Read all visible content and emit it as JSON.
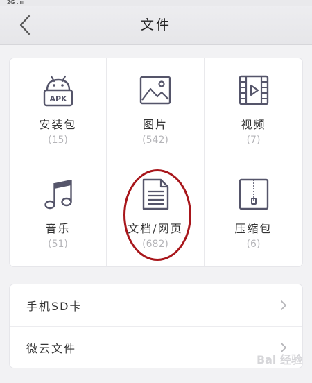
{
  "status_bar": {
    "text": "2G .ıııı"
  },
  "header": {
    "title": "文件",
    "back_icon": "chevron-left-icon"
  },
  "categories": [
    {
      "label": "安装包",
      "count": "(15)",
      "icon": "apk-android-icon"
    },
    {
      "label": "图片",
      "count": "(542)",
      "icon": "image-icon"
    },
    {
      "label": "视频",
      "count": "(7)",
      "icon": "video-icon"
    },
    {
      "label": "音乐",
      "count": "(51)",
      "icon": "music-note-icon"
    },
    {
      "label": "文档/网页",
      "count": "(682)",
      "icon": "document-icon"
    },
    {
      "label": "压缩包",
      "count": "(6)",
      "icon": "zip-archive-icon"
    }
  ],
  "apk_badge": "APK",
  "list": [
    {
      "label": "手机SD卡"
    },
    {
      "label": "微云文件"
    }
  ],
  "watermark": {
    "text": "Bai 经验"
  },
  "colors": {
    "icon": "#55556a",
    "annotation": "#a8161b",
    "count": "#b5b5b9"
  }
}
